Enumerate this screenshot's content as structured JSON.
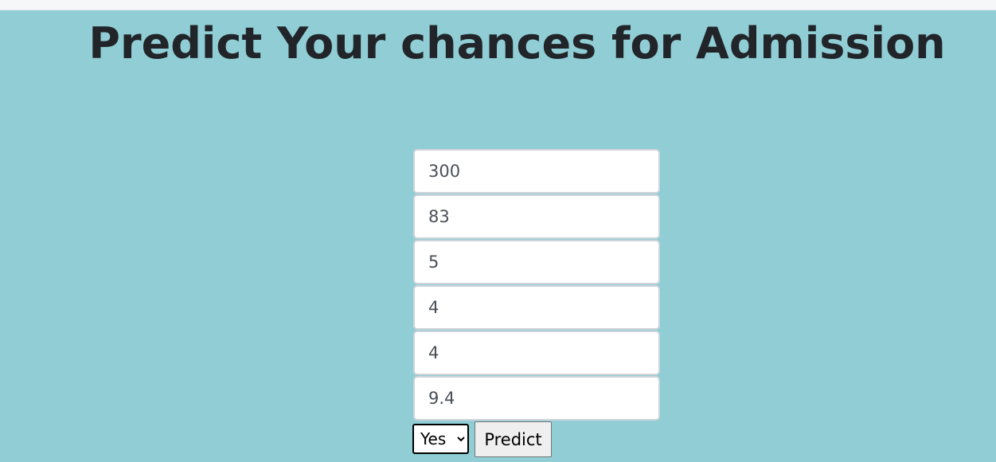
{
  "header": {
    "title": "Predict Your chances for Admission"
  },
  "form": {
    "fields": [
      {
        "value": "300"
      },
      {
        "value": "83"
      },
      {
        "value": "5"
      },
      {
        "value": "4"
      },
      {
        "value": "4"
      },
      {
        "value": "9.4"
      }
    ],
    "select": {
      "selected": "Yes",
      "options": [
        "Yes"
      ]
    },
    "submit_label": "Predict"
  },
  "colors": {
    "page_background": "#90cdd5",
    "title_text": "#212529",
    "field_text": "#495057",
    "field_border": "#ced4da"
  }
}
